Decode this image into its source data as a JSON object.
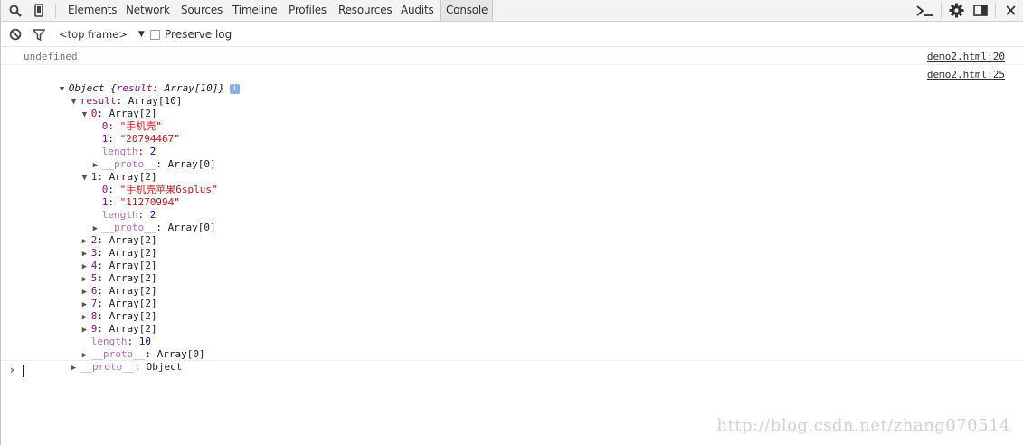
{
  "toolbar": {
    "tabs": [
      "Elements",
      "Network",
      "Sources",
      "Timeline",
      "Profiles",
      "Resources",
      "Audits",
      "Console"
    ],
    "active_tab": "Console",
    "left_icons": [
      "search-icon",
      "device-mode-icon"
    ],
    "right_icons": [
      "console-drawer-icon",
      "gear-icon",
      "dock-side-icon",
      "close-icon"
    ]
  },
  "filterbar": {
    "frame_select": "<top frame>",
    "preserve_log_label": "Preserve log"
  },
  "console": {
    "messages": [
      {
        "text": "undefined",
        "source": "demo2.html:20"
      },
      {
        "source": "demo2.html:25"
      }
    ],
    "object_root": {
      "label": "Object",
      "preview": "{result: Array[10]}"
    },
    "result": {
      "key": "result",
      "value": "Array[10]"
    },
    "item0": {
      "key": "0",
      "value": "Array[2]",
      "el0": {
        "key": "0",
        "value": "\"手机壳\""
      },
      "el1": {
        "key": "1",
        "value": "\"20794467\""
      },
      "length": {
        "key": "length",
        "value": "2"
      },
      "proto": {
        "key": "__proto__",
        "value": "Array[0]"
      }
    },
    "item1": {
      "key": "1",
      "value": "Array[2]",
      "el0": {
        "key": "0",
        "value": "\"手机壳苹果6splus\""
      },
      "el1": {
        "key": "1",
        "value": "\"11270994\""
      },
      "length": {
        "key": "length",
        "value": "2"
      },
      "proto": {
        "key": "__proto__",
        "value": "Array[0]"
      }
    },
    "collapsed_items": [
      {
        "key": "2",
        "value": "Array[2]"
      },
      {
        "key": "3",
        "value": "Array[2]"
      },
      {
        "key": "4",
        "value": "Array[2]"
      },
      {
        "key": "5",
        "value": "Array[2]"
      },
      {
        "key": "6",
        "value": "Array[2]"
      },
      {
        "key": "7",
        "value": "Array[2]"
      },
      {
        "key": "8",
        "value": "Array[2]"
      },
      {
        "key": "9",
        "value": "Array[2]"
      }
    ],
    "result_length": {
      "key": "length",
      "value": "10"
    },
    "result_proto": {
      "key": "__proto__",
      "value": "Array[0]"
    },
    "root_proto": {
      "key": "__proto__",
      "value": "Object"
    },
    "prompt_symbol": "›"
  },
  "watermark": "http://blog.csdn.net/zhang070514",
  "colors": {
    "property_name": "#881280",
    "string": "#c41a16",
    "number": "#1c00cf",
    "prompt": "#2a70d6"
  }
}
